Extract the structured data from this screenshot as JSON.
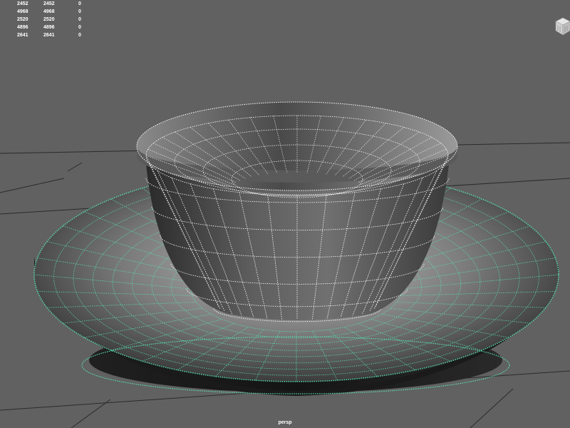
{
  "hud": {
    "rows": [
      [
        "2452",
        "2452",
        "0"
      ],
      [
        "4968",
        "4968",
        "0"
      ],
      [
        "2520",
        "2520",
        "0"
      ],
      [
        "4896",
        "4896",
        "0"
      ],
      [
        "2641",
        "2641",
        "0"
      ]
    ]
  },
  "viewport": {
    "camera_label": "persp",
    "background_color": "#616161",
    "grid_color": "#2b2b2b",
    "cup_wire_color": "#ffffff",
    "saucer_wire_color": "#59e0b2"
  },
  "view_cube": {
    "icon": "view-cube-icon"
  }
}
